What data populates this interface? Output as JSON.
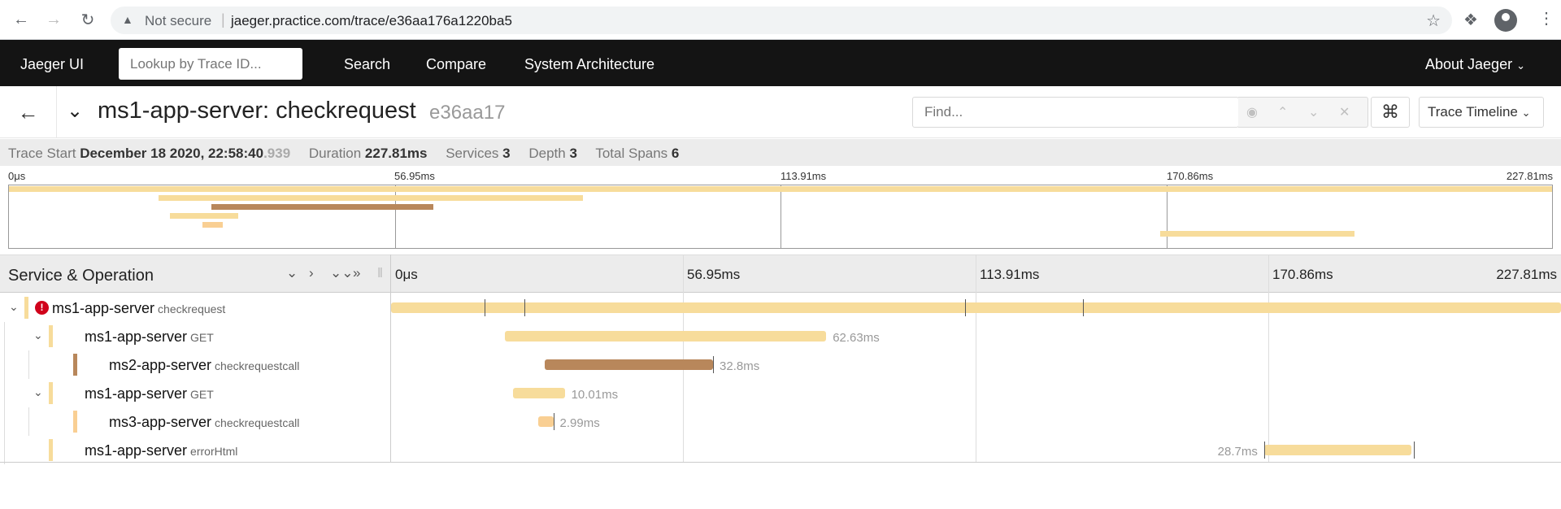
{
  "browser": {
    "not_secure": "Not secure",
    "url": "jaeger.practice.com/trace/e36aa176a1220ba5"
  },
  "nav": {
    "brand": "Jaeger UI",
    "lookup_placeholder": "Lookup by Trace ID...",
    "links": [
      "Search",
      "Compare",
      "System Architecture"
    ],
    "about": "About Jaeger"
  },
  "trace": {
    "title": "ms1-app-server: checkrequest",
    "short_id": "e36aa17",
    "find_placeholder": "Find...",
    "view_mode": "Trace Timeline"
  },
  "summary": {
    "start_label": "Trace Start",
    "start_value": "December 18 2020, 22:58:40",
    "start_ms": ".939",
    "duration_label": "Duration",
    "duration_value": "227.81ms",
    "services_label": "Services",
    "services_value": "3",
    "depth_label": "Depth",
    "depth_value": "3",
    "spans_label": "Total Spans",
    "spans_value": "6"
  },
  "timeline": {
    "header_title": "Service & Operation",
    "ticks": [
      "0μs",
      "56.95ms",
      "113.91ms",
      "170.86ms",
      "227.81ms"
    ],
    "total_ms": 227.81
  },
  "colors": {
    "ms1": "#f7dc9b",
    "ms2": "#b8875b",
    "ms3": "#f9cf93",
    "error": "#d0021b"
  },
  "spans": [
    {
      "service": "ms1-app-server",
      "operation": "checkrequest",
      "depth": 0,
      "collapsible": true,
      "error": true,
      "color": "ms1",
      "start_ms": 0,
      "duration_ms": 227.81,
      "label": "",
      "logs_ms": [
        18.2,
        25.9,
        111.7,
        134.7
      ]
    },
    {
      "service": "ms1-app-server",
      "operation": "GET",
      "depth": 1,
      "collapsible": true,
      "error": false,
      "color": "ms1",
      "start_ms": 22.1,
      "duration_ms": 62.63,
      "label": "62.63ms",
      "logs_ms": []
    },
    {
      "service": "ms2-app-server",
      "operation": "checkrequestcall",
      "depth": 2,
      "collapsible": false,
      "error": false,
      "color": "ms2",
      "start_ms": 29.9,
      "duration_ms": 32.8,
      "label": "32.8ms",
      "logs_ms": [
        62.7
      ]
    },
    {
      "service": "ms1-app-server",
      "operation": "GET",
      "depth": 1,
      "collapsible": true,
      "error": false,
      "color": "ms1",
      "start_ms": 23.8,
      "duration_ms": 10.01,
      "label": "10.01ms",
      "logs_ms": []
    },
    {
      "service": "ms3-app-server",
      "operation": "checkrequestcall",
      "depth": 2,
      "collapsible": false,
      "error": false,
      "color": "ms3",
      "start_ms": 28.6,
      "duration_ms": 2.99,
      "label": "2.99ms",
      "logs_ms": [
        31.6
      ]
    },
    {
      "service": "ms1-app-server",
      "operation": "errorHtml",
      "depth": 1,
      "collapsible": false,
      "error": false,
      "color": "ms1",
      "start_ms": 170.0,
      "duration_ms": 28.7,
      "label": "28.7ms",
      "label_left": true,
      "logs_ms": [
        170.0,
        199.2
      ]
    }
  ]
}
